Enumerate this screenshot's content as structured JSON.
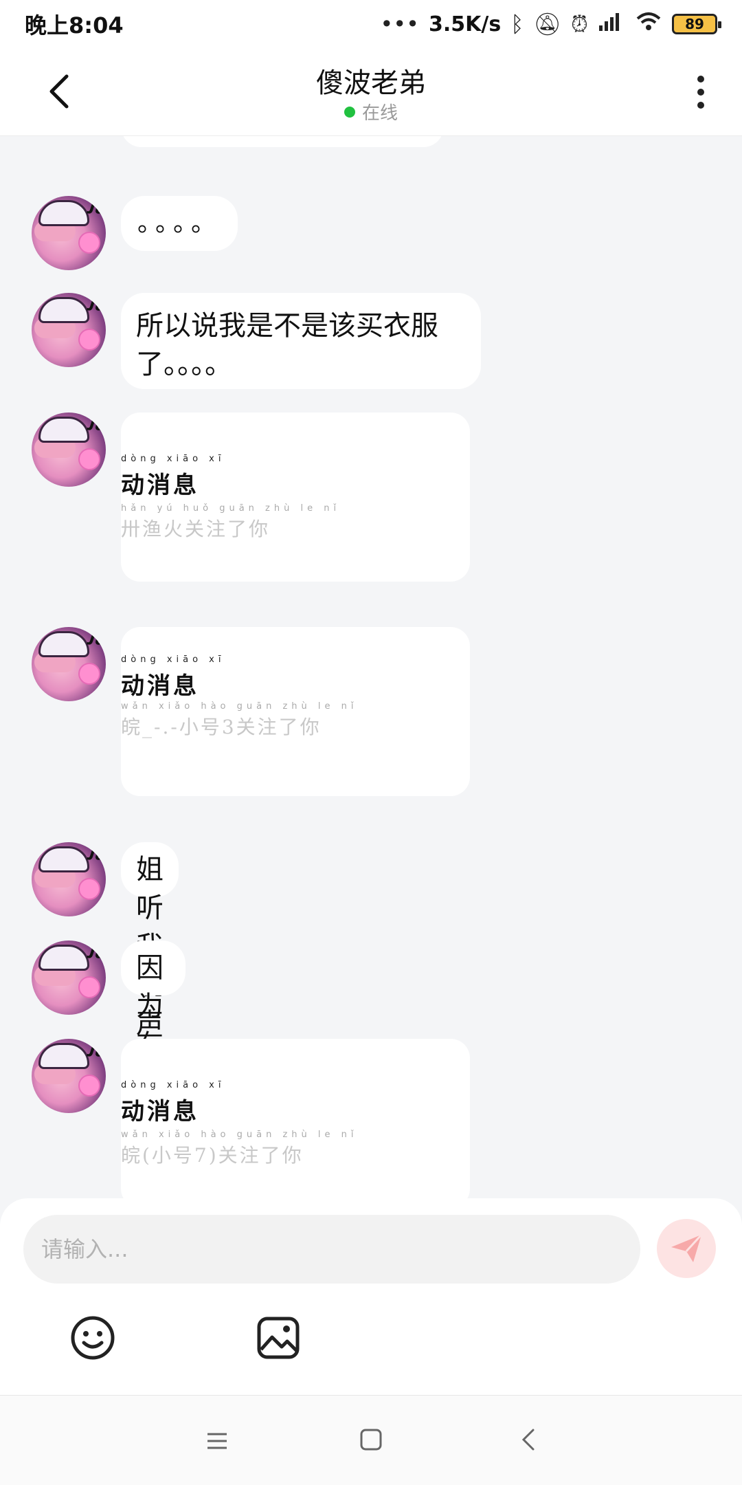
{
  "status_bar": {
    "time": "晚上8:04",
    "network_speed": "3.5K/s",
    "battery": "89",
    "icons": [
      "bluetooth-icon",
      "mute-icon",
      "alarm-icon",
      "signal-icon",
      "wifi-icon"
    ]
  },
  "header": {
    "title": "傻波老弟",
    "status": "在线",
    "status_color": "#21c140"
  },
  "messages": [
    {
      "type": "text",
      "text": "。。。。"
    },
    {
      "type": "text",
      "text": "所以说我是不是该买衣服了。。。。"
    },
    {
      "type": "card",
      "title": "动消息",
      "pinyin_title": "dòng xiāo xī",
      "subtitle": "卅渔火关注了你",
      "pinyin_sub": "hǎn yú huǒ guān zhù le nǐ"
    },
    {
      "type": "card",
      "title": "动消息",
      "pinyin_title": "dòng xiāo xī",
      "subtitle": "皖_-.-小号3关注了你",
      "pinyin_sub": "wǎn xiǎo hào guān zhù le nǐ"
    },
    {
      "type": "text",
      "text": "姐听我说声谢谢你~"
    },
    {
      "type": "text",
      "text": "因为有你感动了四季💢"
    },
    {
      "type": "card",
      "title": "动消息",
      "pinyin_title": "dòng xiāo xī",
      "subtitle": "皖(小号7)关注了你",
      "pinyin_sub": "wǎn xiǎo hào guān zhù le nǐ"
    }
  ],
  "input": {
    "placeholder": "请输入..."
  },
  "colors": {
    "background": "#f4f5f7",
    "bubble": "#ffffff",
    "send_button": "#fde3e3",
    "send_icon": "#f7a9a9"
  }
}
